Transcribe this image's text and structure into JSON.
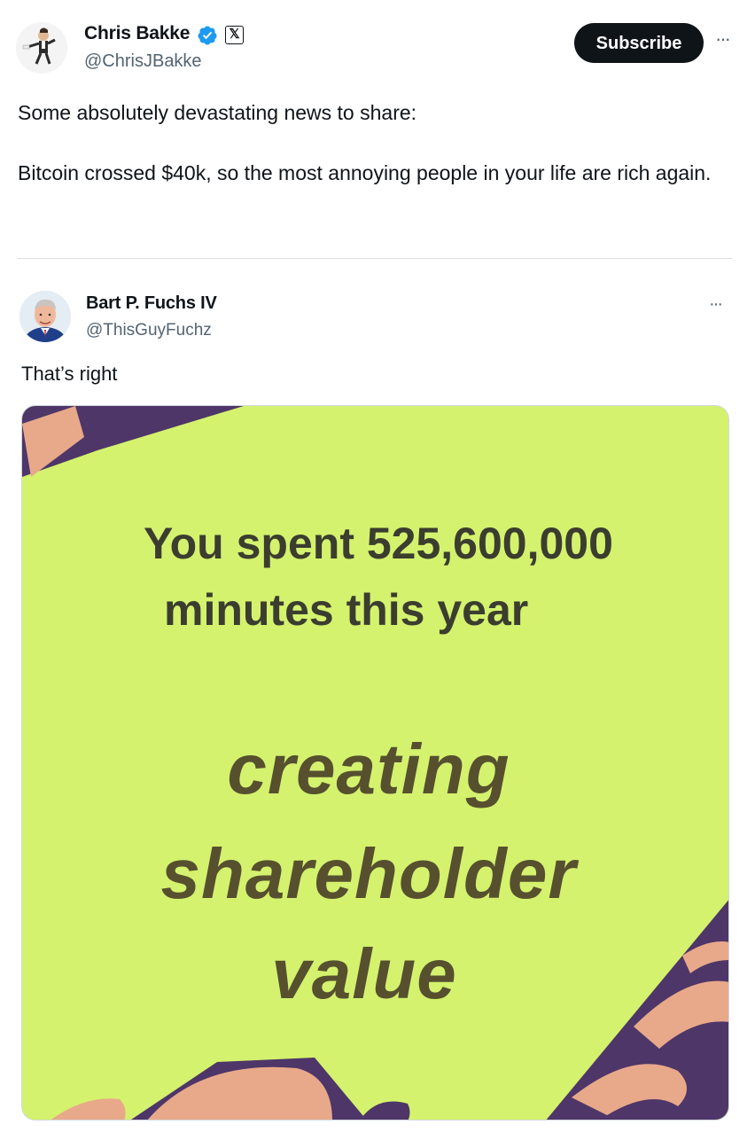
{
  "tweet": {
    "author_name": "Chris Bakke",
    "author_handle": "@ChrisJBakke",
    "x_badge": "𝕏",
    "subscribe_label": "Subscribe",
    "more_label": "···",
    "text_line1": "Some absolutely devastating news to share:",
    "text_line2": "Bitcoin crossed $40k, so the most annoying people in your life are rich again."
  },
  "quote": {
    "author_name": "Bart P. Fuchs IV",
    "author_handle": "@ThisGuyFuchz",
    "more_label": "···",
    "text": "That’s right",
    "image": {
      "line1": "You spent 525,600,000",
      "line2": "minutes this year",
      "big1": "creating",
      "big2": "shareholder",
      "big3": "value"
    }
  },
  "colors": {
    "meme_background": "#d4f26e",
    "meme_purple": "#4e3668",
    "meme_peach": "#e8a98a",
    "verified_blue": "#1d9bf0"
  }
}
